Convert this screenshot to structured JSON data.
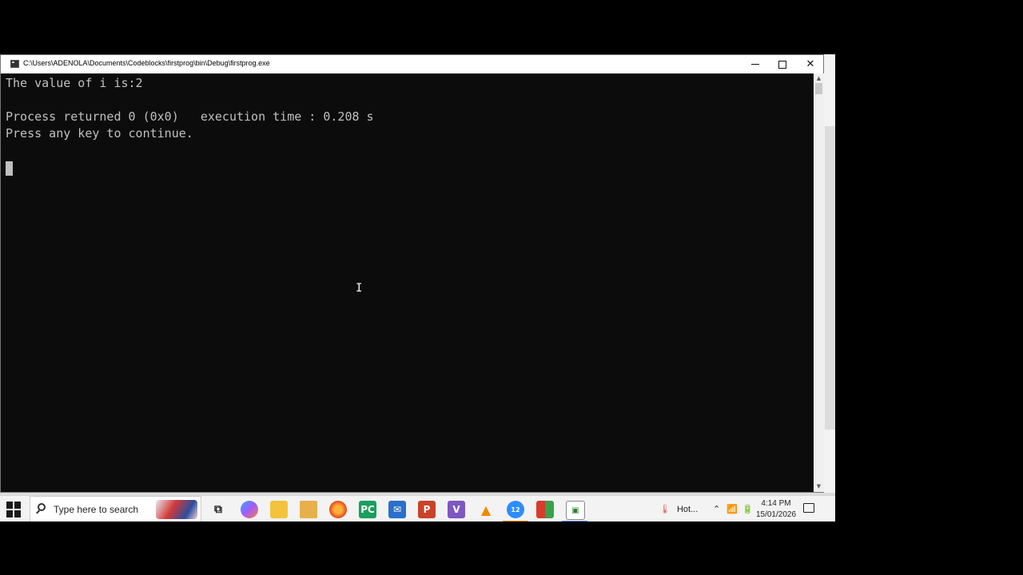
{
  "window": {
    "title": "C:\\Users\\ADENOLA\\Documents\\Codeblocks\\firstprog\\bin\\Debug\\firstprog.exe",
    "close_glyph": "✕"
  },
  "console": {
    "lines": [
      "The value of i is:2",
      "",
      "Process returned 0 (0x0)   execution time : 0.208 s",
      "Press any key to continue."
    ],
    "text_color": "#c0c0c0",
    "background": "#0c0c0c"
  },
  "mouse": {
    "glyph": "I"
  },
  "taskbar": {
    "search_placeholder": "Type here to search",
    "weather_text": "Hot...",
    "time": "4:14 PM",
    "date": "15/01/2026",
    "zoom_badge": "12",
    "icons": [
      "task-view-icon",
      "copilot-icon",
      "file-explorer-icon",
      "media-icon",
      "firefox-icon",
      "pycharm-icon",
      "outlook-icon",
      "powerpoint-icon",
      "visual-studio-icon",
      "vlc-icon",
      "zoom-icon",
      "codeblocks-icon",
      "console-icon"
    ]
  }
}
